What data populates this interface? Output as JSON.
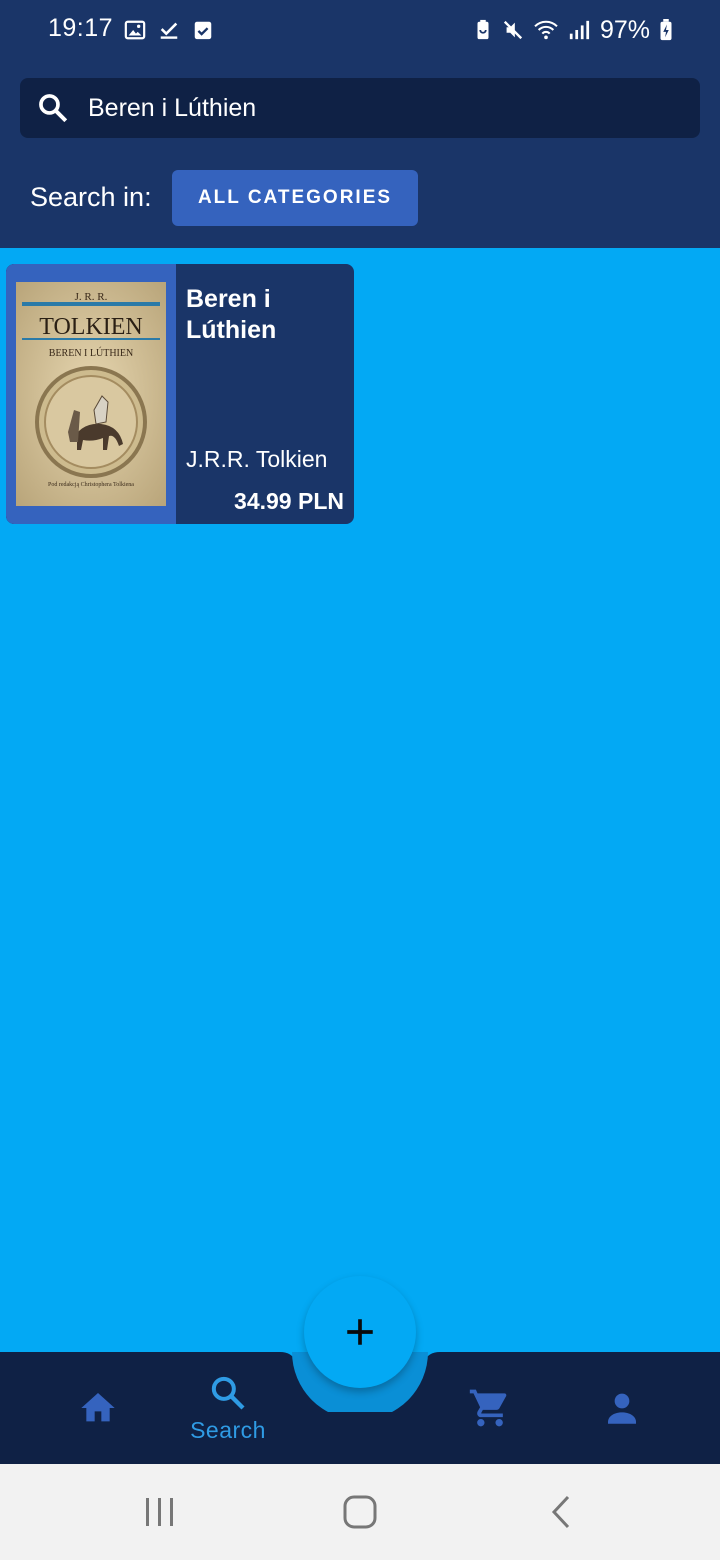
{
  "status_bar": {
    "time": "19:17",
    "battery_percent": "97%",
    "left_icons": [
      "image-icon",
      "check-download-icon",
      "calendar-check-icon"
    ],
    "right_icons": [
      "battery-saver-icon",
      "mute-icon",
      "wifi-icon",
      "signal-icon",
      "battery-charging-icon"
    ]
  },
  "search": {
    "value": "Beren i Lúthien",
    "search_in_label": "Search in:",
    "category_button": "ALL CATEGORIES"
  },
  "results": [
    {
      "title": "Beren i Lúthien",
      "author": "J.R.R. Tolkien",
      "price": "34.99 PLN",
      "cover": {
        "author_line": "J. R. R.",
        "surname": "TOLKIEN",
        "title_line": "BEREN I LÚTHIEN",
        "footer_line": "Pod redakcją Christophera Tolkiena"
      }
    }
  ],
  "bottom_nav": {
    "items": [
      {
        "name": "home",
        "icon": "home-icon",
        "label": ""
      },
      {
        "name": "search",
        "icon": "search-icon",
        "label": "Search"
      },
      {
        "name": "cart",
        "icon": "cart-icon",
        "label": ""
      },
      {
        "name": "account",
        "icon": "person-icon",
        "label": ""
      }
    ],
    "fab_icon": "plus-icon"
  },
  "colors": {
    "header": "#1a3568",
    "background": "#03a9f4",
    "nav_bar": "#0f2145",
    "accent_button": "#3563be",
    "active_nav": "#2f9be4"
  }
}
